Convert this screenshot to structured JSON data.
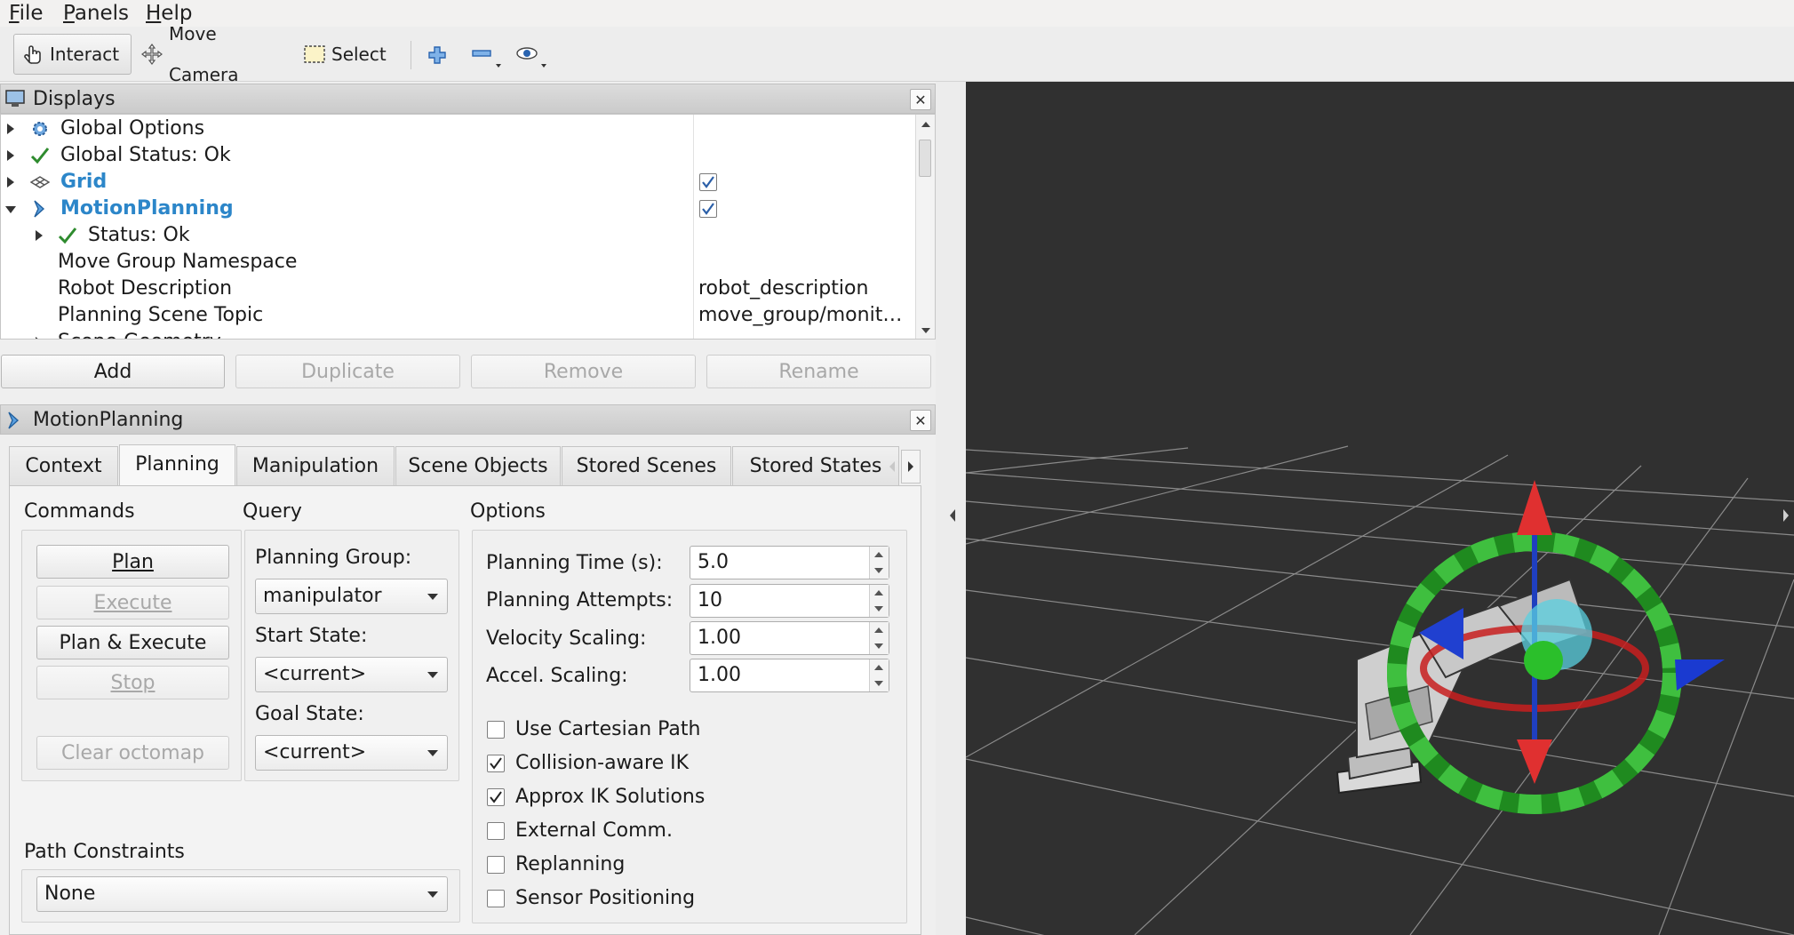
{
  "menu": [
    {
      "label": "File",
      "accel": "F",
      "rest": "ile"
    },
    {
      "label": "Panels",
      "accel": "P",
      "rest": "anels"
    },
    {
      "label": "Help",
      "accel": "H",
      "rest": "elp"
    }
  ],
  "toolbar": {
    "interact": "Interact",
    "move_camera": "Move Camera",
    "select": "Select",
    "icons": [
      "plus-icon",
      "minus-icon",
      "eye-icon"
    ]
  },
  "displays": {
    "title": "Displays",
    "rows": [
      {
        "label": "Global Options",
        "icon": "gear-icon"
      },
      {
        "label": "Global Status: Ok",
        "icon": "check-icon"
      },
      {
        "label": "Grid",
        "icon": "grid-icon",
        "checked": true
      },
      {
        "label": "MotionPlanning",
        "icon": "motion-planning-icon",
        "checked": true
      },
      {
        "label": "Status: Ok",
        "icon": "check-icon"
      },
      {
        "label": "Move Group Namespace",
        "value": ""
      },
      {
        "label": "Robot Description",
        "value": "robot_description"
      },
      {
        "label": "Planning Scene Topic",
        "value": "move_group/monit…"
      },
      {
        "label": "Scene Geometry"
      }
    ],
    "buttons": {
      "add": "Add",
      "duplicate": "Duplicate",
      "remove": "Remove",
      "rename": "Rename"
    }
  },
  "motion_planning": {
    "title": "MotionPlanning",
    "tabs": [
      "Context",
      "Planning",
      "Manipulation",
      "Scene Objects",
      "Stored Scenes",
      "Stored States"
    ],
    "active_tab": "Planning",
    "commands": {
      "title": "Commands",
      "plan": "Plan",
      "execute": "Execute",
      "plan_execute": "Plan & Execute",
      "stop": "Stop",
      "clear_octomap": "Clear octomap"
    },
    "query": {
      "title": "Query",
      "planning_group_label": "Planning Group:",
      "planning_group": "manipulator",
      "start_state_label": "Start State:",
      "start_state": "<current>",
      "goal_state_label": "Goal State:",
      "goal_state": "<current>"
    },
    "options": {
      "title": "Options",
      "planning_time_label": "Planning Time (s):",
      "planning_time": "5.0",
      "planning_attempts_label": "Planning Attempts:",
      "planning_attempts": "10",
      "velocity_scaling_label": "Velocity Scaling:",
      "velocity_scaling": "1.00",
      "accel_scaling_label": "Accel. Scaling:",
      "accel_scaling": "1.00",
      "checkboxes": [
        {
          "label": "Use Cartesian Path",
          "checked": false
        },
        {
          "label": "Collision-aware IK",
          "checked": true
        },
        {
          "label": "Approx IK Solutions",
          "checked": true
        },
        {
          "label": "External Comm.",
          "checked": false
        },
        {
          "label": "Replanning",
          "checked": false
        },
        {
          "label": "Sensor Positioning",
          "checked": false
        }
      ]
    },
    "path_constraints": {
      "title": "Path Constraints",
      "value": "None"
    }
  },
  "colors": {
    "viewport_bg": "#303030",
    "grid_line": "#8a8a8a",
    "ring_green": "#2ca02c",
    "axis_red": "#d62728",
    "axis_blue": "#1f3fbf",
    "accent_blue": "#2c86c9"
  }
}
